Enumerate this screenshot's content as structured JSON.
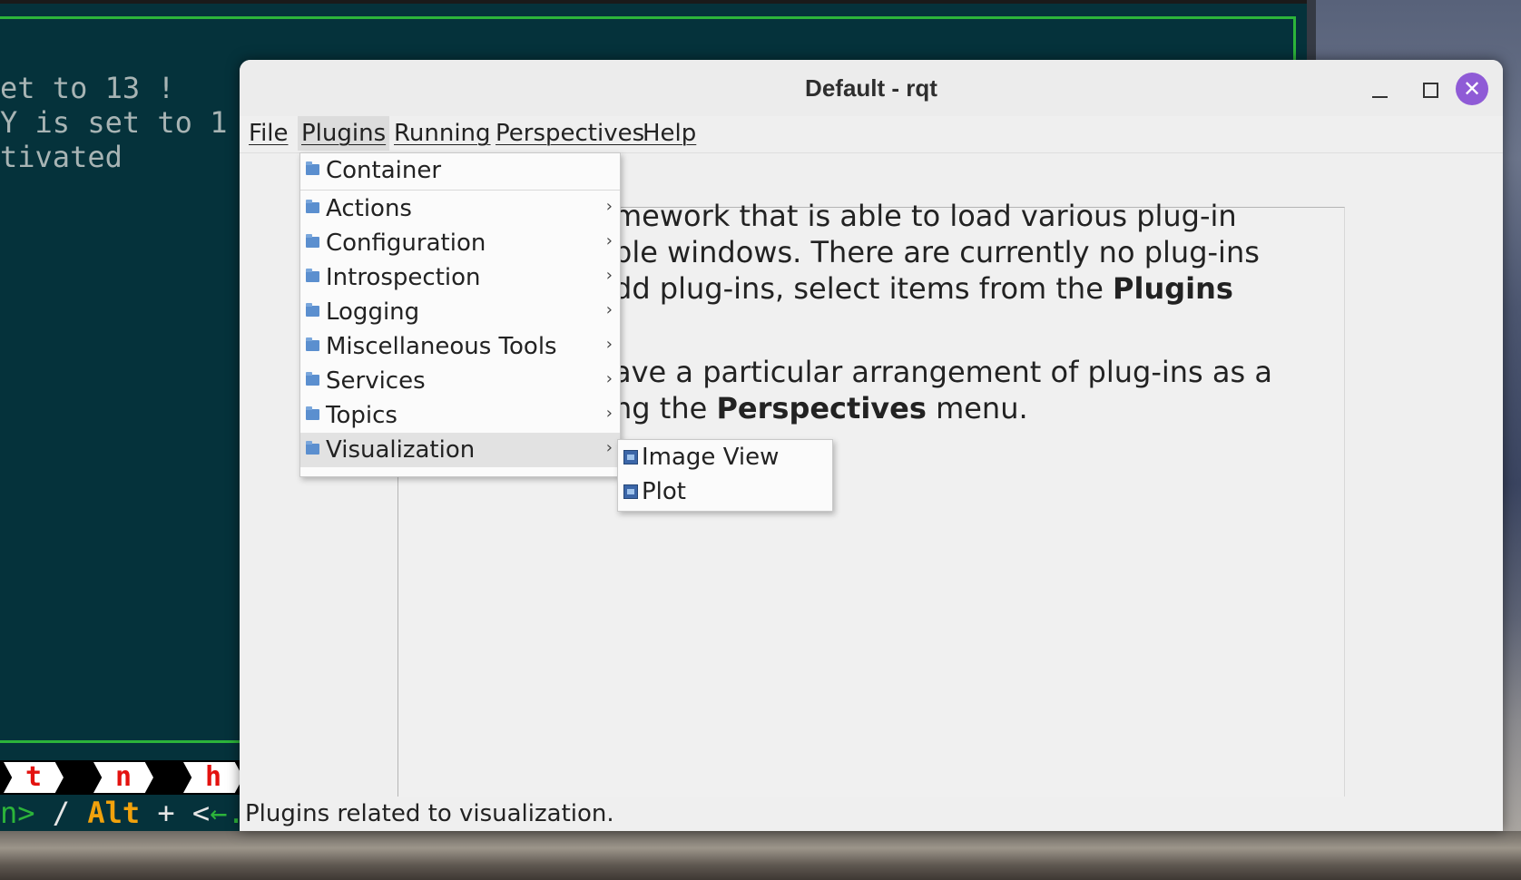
{
  "terminal": {
    "lines": [
      "et to 13 !",
      "Y is set to 1",
      "tivated"
    ],
    "keys": [
      "t",
      "n",
      "h"
    ],
    "hint": {
      "part1": "n>",
      "part2": " / ",
      "part3": "Alt",
      "part4": " + <",
      "part5": "←."
    }
  },
  "window": {
    "title": "Default - rqt",
    "close_symbol": "✕"
  },
  "menubar": {
    "items": [
      "File",
      "Plugins",
      "Running",
      "Perspectives",
      "Help"
    ]
  },
  "content": {
    "line1": "mework that is able to load various plug-in",
    "line2": "ble windows. There are currently no plug-ins",
    "line3_prefix": "dd plug-ins, select items from the ",
    "line3_bold": "Plugins",
    "line4": "ave a particular arrangement of plug-ins as a",
    "line5_prefix": "ng the ",
    "line5_bold": "Perspectives",
    "line5_suffix": " menu."
  },
  "plugins_menu": {
    "items": [
      {
        "label": "Container"
      },
      {
        "label": "Actions",
        "arrow": "›"
      },
      {
        "label": "Configuration",
        "arrow": "›"
      },
      {
        "label": "Introspection",
        "arrow": "›"
      },
      {
        "label": "Logging",
        "arrow": "›"
      },
      {
        "label": "Miscellaneous Tools",
        "arrow": "›"
      },
      {
        "label": "Services",
        "arrow": "›"
      },
      {
        "label": "Topics",
        "arrow": "›"
      },
      {
        "label": "Visualization",
        "arrow": "›"
      }
    ]
  },
  "visualization_submenu": {
    "items": [
      {
        "label": "Image View"
      },
      {
        "label": "Plot"
      }
    ]
  },
  "statusbar": {
    "text": "Plugins related to visualization."
  },
  "colors": {
    "terminal_bg": "#05323b",
    "terminal_green": "#2cb43a",
    "close_button": "#8f5bd6",
    "window_bg": "#efefef"
  }
}
